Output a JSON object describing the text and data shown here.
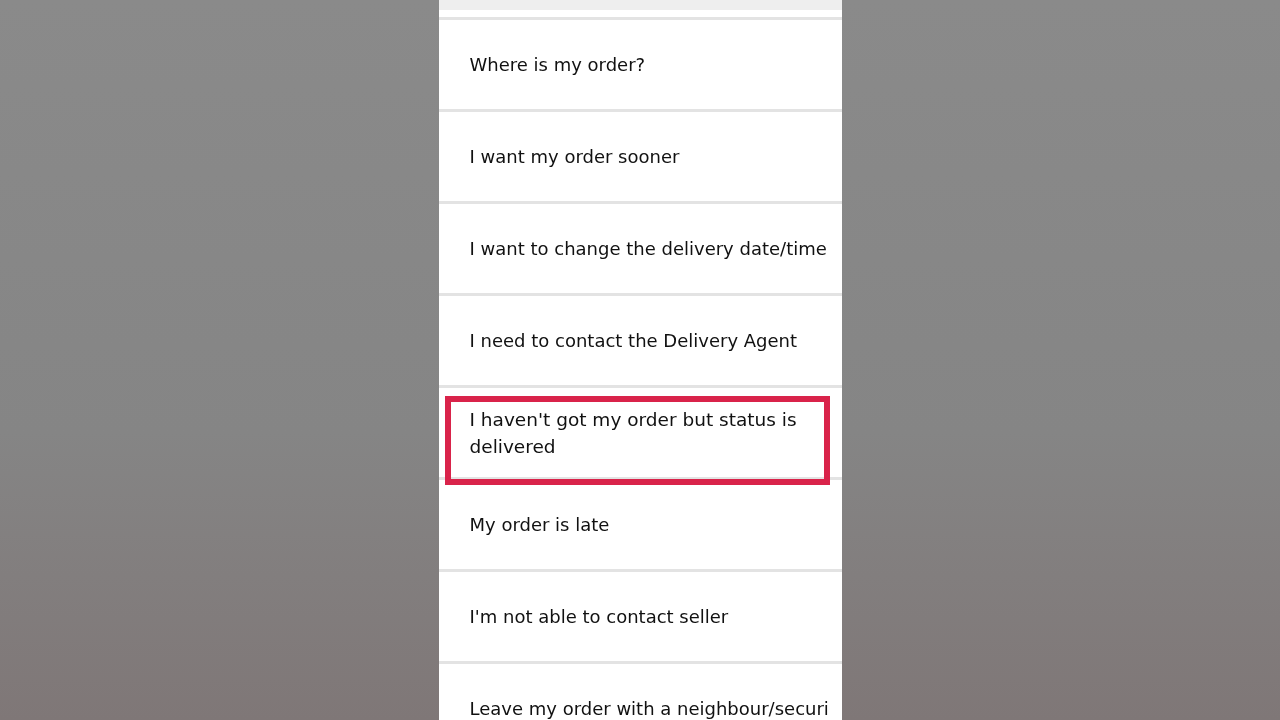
{
  "help_topics": [
    {
      "label": "Where is my order?",
      "highlighted": false
    },
    {
      "label": "I want my order sooner",
      "highlighted": false
    },
    {
      "label": "I want to change the delivery date/time",
      "highlighted": false
    },
    {
      "label": "I need to contact the Delivery Agent",
      "highlighted": false
    },
    {
      "label": "I haven't got my order but status is delivered",
      "highlighted": true
    },
    {
      "label": "My order is late",
      "highlighted": false
    },
    {
      "label": "I'm not able to contact seller",
      "highlighted": false
    },
    {
      "label": "Leave my order with a neighbour/securi",
      "highlighted": false
    }
  ]
}
